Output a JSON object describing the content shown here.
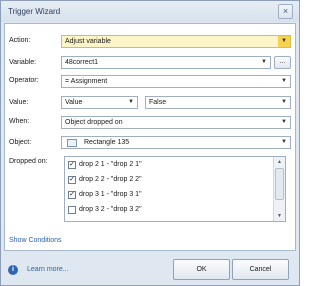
{
  "window": {
    "title": "Trigger Wizard",
    "close_glyph": "×"
  },
  "form": {
    "action": {
      "label": "Action:",
      "value": "Adjust variable"
    },
    "variable": {
      "label": "Variable:",
      "value": "48correct1",
      "browse_label": "..."
    },
    "operator": {
      "label": "Operator:",
      "value": "= Assignment"
    },
    "value": {
      "label": "Value:",
      "type": "Value",
      "value": "False"
    },
    "when": {
      "label": "When:",
      "value": "Object dropped on"
    },
    "object": {
      "label": "Object:",
      "value": "Rectangle 135"
    },
    "dropped_on": {
      "label": "Dropped on:",
      "items": [
        {
          "label": "drop 2 1 - \"drop 2 1\"",
          "checked": true
        },
        {
          "label": "drop 2 2 - \"drop 2 2\"",
          "checked": true
        },
        {
          "label": "drop 3 1 - \"drop 3 1\"",
          "checked": true
        },
        {
          "label": "drop 3 2 - \"drop 3 2\"",
          "checked": false
        }
      ]
    },
    "show_conditions": "Show Conditions"
  },
  "footer": {
    "help_icon": "i",
    "learn_more": "Learn more...",
    "ok_label": "OK",
    "cancel_label": "Cancel"
  },
  "colors": {
    "accent": "#f7d24f",
    "link": "#2e62a8",
    "frame": "#dfe7f0"
  }
}
